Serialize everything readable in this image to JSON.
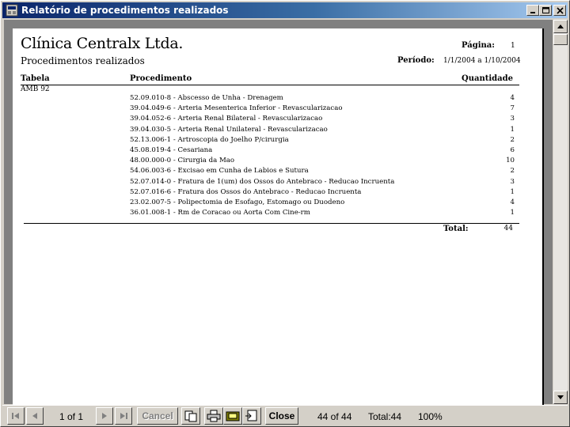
{
  "window": {
    "title": "Relatório de procedimentos realizados"
  },
  "report": {
    "company": "Clínica Centralx Ltda.",
    "subtitle": "Procedimentos realizados",
    "page_label": "Página:",
    "page_value": "1",
    "period_label": "Período:",
    "period_value": "1/1/2004 a 1/10/2004",
    "columns": {
      "tabela": "Tabela",
      "procedimento": "Procedimento",
      "quantidade": "Quantidade"
    },
    "group": "AMB 92",
    "rows": [
      {
        "proc": "52.09.010-8 - Abscesso de Unha - Drenagem",
        "qty": "4"
      },
      {
        "proc": "39.04.049-6 - Arteria Mesenterica Inferior - Revascularizacao",
        "qty": "7"
      },
      {
        "proc": "39.04.052-6 - Arteria Renal Bilateral - Revascularizacao",
        "qty": "3"
      },
      {
        "proc": "39.04.030-5 - Arteria Renal Unilateral - Revascularizacao",
        "qty": "1"
      },
      {
        "proc": "52.13.006-1 - Artroscopia do Joelho P/cirurgia",
        "qty": "2"
      },
      {
        "proc": "45.08.019-4 - Cesariana",
        "qty": "6"
      },
      {
        "proc": "48.00.000-0 - Cirurgia da Mao",
        "qty": "10"
      },
      {
        "proc": "54.06.003-6 - Excisao em Cunha de Labios e Sutura",
        "qty": "2"
      },
      {
        "proc": "52.07.014-0 - Fratura de 1(um) dos Ossos do Antebraco - Reducao Incruenta",
        "qty": "3"
      },
      {
        "proc": "52.07.016-6 - Fratura dos Ossos do Antebraco - Reducao Incruenta",
        "qty": "1"
      },
      {
        "proc": "23.02.007-5 - Polipectomia de Esofago, Estomago ou Duodeno",
        "qty": "4"
      },
      {
        "proc": "36.01.008-1 - Rm de Coracao ou Aorta Com Cine-rm",
        "qty": "1"
      }
    ],
    "total_label": "Total:",
    "total_value": "44"
  },
  "toolbar": {
    "page_indicator": "1 of 1",
    "cancel_label": "Cancel",
    "close_label": "Close",
    "records": "44 of 44",
    "total": "Total:44",
    "zoom": "100%"
  },
  "colors": {
    "titlebar_start": "#0a246a",
    "titlebar_end": "#a6caf0",
    "chrome": "#d4d0c8",
    "viewport_bg": "#808080"
  }
}
